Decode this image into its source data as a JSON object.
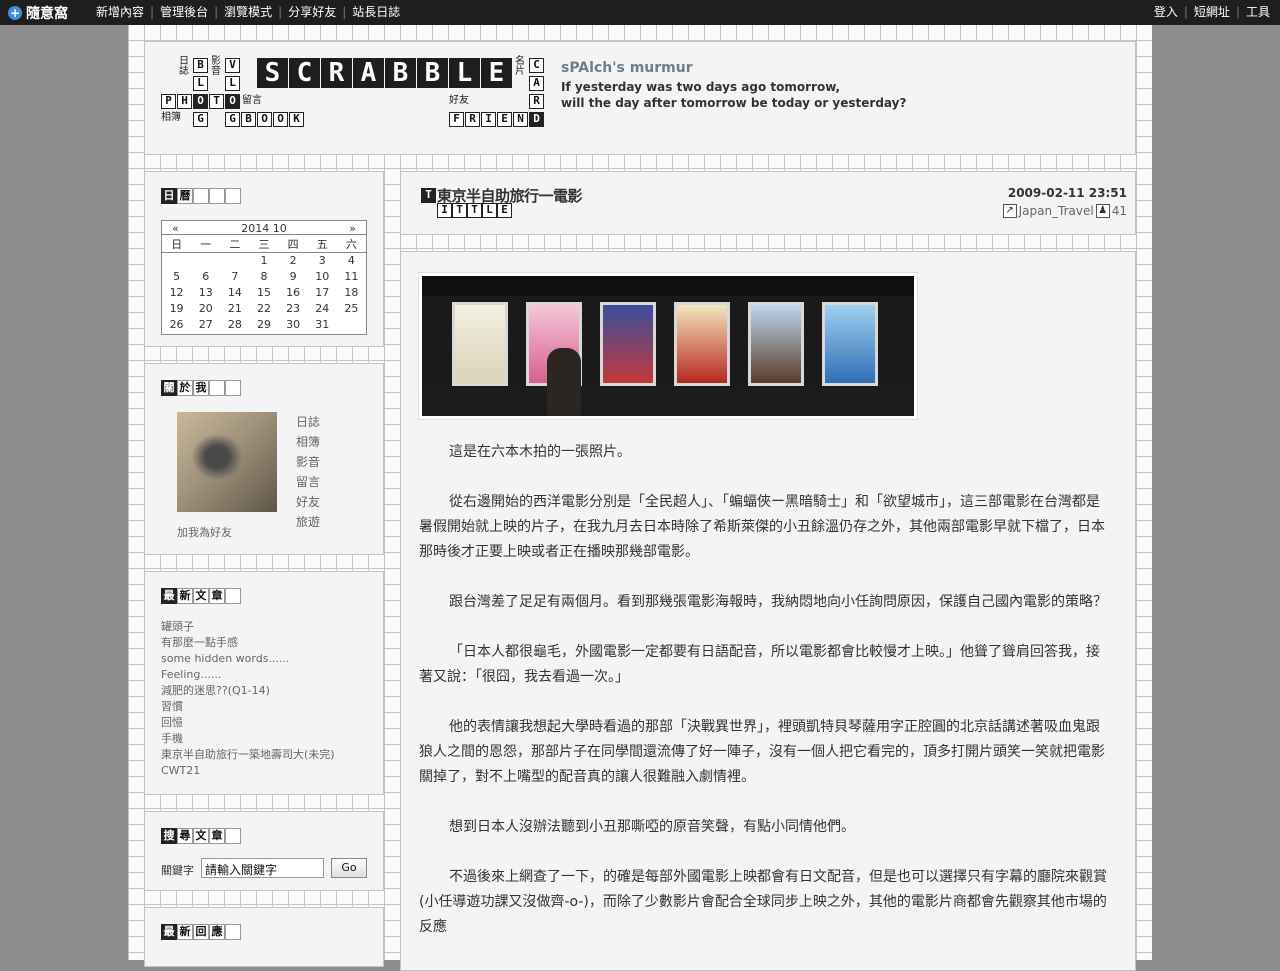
{
  "topbar": {
    "logo_text": "隨意窩",
    "left_links": [
      "新增內容",
      "管理後台",
      "瀏覽模式",
      "分享好友",
      "站長日誌"
    ],
    "right_links": [
      "登入",
      "短網址",
      "工具"
    ]
  },
  "header": {
    "scrabble": "SCRABBLE",
    "labels": {
      "blog": "日誌",
      "vlog": "影音",
      "photo": "相簿",
      "gbook": "留言",
      "card": "名片",
      "friend": "好友"
    },
    "tiles": {
      "blog": [
        "B",
        "L",
        "O",
        "G"
      ],
      "vlog": [
        "V",
        "L",
        "O",
        "G"
      ],
      "photo": [
        "P",
        "H",
        "O",
        "T",
        "O"
      ],
      "gbook": [
        "G",
        "B",
        "O",
        "O",
        "K"
      ],
      "card": [
        "C",
        "A",
        "R",
        "D"
      ],
      "friend": [
        "F",
        "R",
        "I",
        "E",
        "N",
        "D"
      ]
    },
    "blog_title": "sPAlch's murmur",
    "description_line1": "If yesterday was two days ago tomorrow,",
    "description_line2": "will the day after tomorrow be today or yesterday?"
  },
  "calendar": {
    "title": [
      "日",
      "曆"
    ],
    "prev": "«",
    "next": "»",
    "month_label": "2014 10",
    "weekdays": [
      "日",
      "一",
      "二",
      "三",
      "四",
      "五",
      "六"
    ],
    "weeks": [
      [
        "",
        "",
        "",
        "1",
        "2",
        "3",
        "4"
      ],
      [
        "5",
        "6",
        "7",
        "8",
        "9",
        "10",
        "11"
      ],
      [
        "12",
        "13",
        "14",
        "15",
        "16",
        "17",
        "18"
      ],
      [
        "19",
        "20",
        "21",
        "22",
        "23",
        "24",
        "25"
      ],
      [
        "26",
        "27",
        "28",
        "29",
        "30",
        "31",
        ""
      ]
    ]
  },
  "about": {
    "title": [
      "關",
      "於",
      "我"
    ],
    "links": [
      "日誌",
      "相簿",
      "影音",
      "留言",
      "好友",
      "旅遊"
    ],
    "add_friend": "加我為好友"
  },
  "recent": {
    "title": [
      "最",
      "新",
      "文",
      "章"
    ],
    "items": [
      "罐頭子",
      "有那麼一點手感",
      "some hidden words......",
      "Feeling......",
      "減肥的迷思??(Q1-14)",
      "習慣",
      "回憶",
      "手機",
      "東京半自助旅行一築地壽司大(未完)",
      "CWT21"
    ]
  },
  "search": {
    "title": [
      "搜",
      "尋",
      "文",
      "章"
    ],
    "label": "關鍵字",
    "value": "請輸入關鍵字",
    "go": "Go"
  },
  "replies": {
    "title": [
      "最",
      "新",
      "回",
      "應"
    ]
  },
  "post": {
    "title_letter": "T",
    "title": "東京半自助旅行一電影",
    "title_tiles": [
      "I",
      "T",
      "T",
      "L",
      "E"
    ],
    "date": "2009-02-11 23:51",
    "category": "Japan_Travel",
    "views": "41",
    "paragraphs": [
      "這是在六本木拍的一張照片。",
      "從右邊開始的西洋電影分別是「全民超人」、「蝙蝠俠ー黑暗騎士」和「欲望城市」，這三部電影在台灣都是暑假開始就上映的片子，在我九月去日本時除了希斯萊傑的小丑餘溫仍存之外，其他兩部電影早就下檔了，日本那時後才正要上映或者正在播映那幾部電影。",
      "跟台灣差了足足有兩個月。看到那幾張電影海報時，我納悶地向小任詢問原因，保護自己國內電影的策略？",
      "「日本人都很龜毛，外國電影一定都要有日語配音，所以電影都會比較慢才上映。」他聳了聳肩回答我，接著又說：「很囧，我去看過一次。」",
      "他的表情讓我想起大學時看過的那部「決戰異世界」，裡頭凱特貝琴薩用字正腔圓的北京話講述著吸血鬼跟狼人之間的恩怨，那部片子在同學間還流傳了好一陣子，沒有一個人把它看完的，頂多打開片頭笑一笑就把電影關掉了，對不上嘴型的配音真的讓人很難融入劇情裡。",
      "想到日本人沒辦法聽到小丑那嘶啞的原音笑聲，有點小同情他們。",
      "不過後來上網查了一下，的確是每部外國電影上映都會有日文配音，但是也可以選擇只有字幕的廳院來觀賞(小任導遊功課又沒做齊-o-)，而除了少數影片會配合全球同步上映之外，其他的電影片商都會先觀察其他市場的反應"
    ]
  }
}
